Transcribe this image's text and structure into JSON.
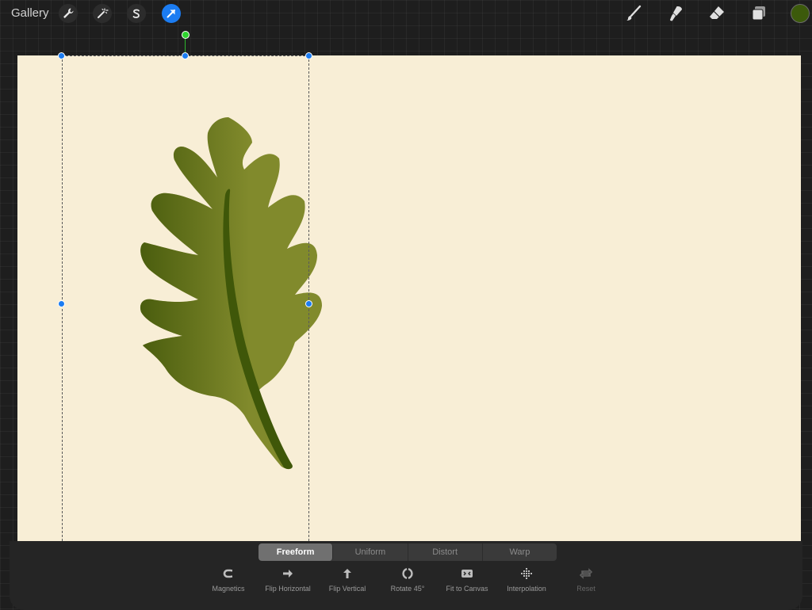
{
  "topbar": {
    "gallery_label": "Gallery",
    "tools_left": [
      "wrench-icon",
      "magic-wand-icon",
      "selection-s-icon",
      "transform-arrow-icon"
    ],
    "tools_right": [
      "brush-icon",
      "smudge-icon",
      "eraser-icon",
      "layers-icon"
    ],
    "active_tool": "transform-arrow-icon",
    "accent_color": "#1b7cf2",
    "current_color": "#3c5a0b"
  },
  "canvas": {
    "background": "#f8eed6",
    "leaf_fill": "#818a2c",
    "leaf_shade": "#4a5d0e",
    "leaf_vein": "#3f5709"
  },
  "modes": {
    "items": [
      "Freeform",
      "Uniform",
      "Distort",
      "Warp"
    ],
    "selected": "Freeform"
  },
  "actions": {
    "magnetics": "Magnetics",
    "flip_horizontal": "Flip Horizontal",
    "flip_vertical": "Flip Vertical",
    "rotate": "Rotate 45°",
    "fit_to_canvas": "Fit to Canvas",
    "interpolation": "Interpolation",
    "reset": "Reset"
  }
}
